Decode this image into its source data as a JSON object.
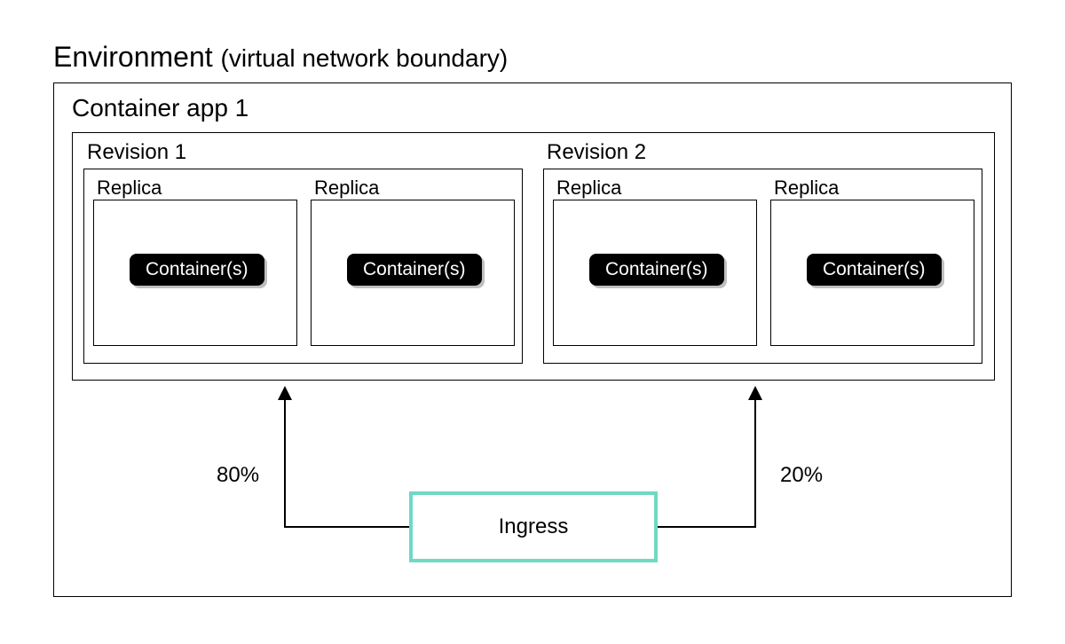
{
  "title_main": "Environment",
  "title_sub": "(virtual network boundary)",
  "app": {
    "title": "Container app 1",
    "revisions": [
      {
        "title": "Revision 1",
        "replicas": [
          {
            "title": "Replica",
            "container_label": "Container(s)"
          },
          {
            "title": "Replica",
            "container_label": "Container(s)"
          }
        ]
      },
      {
        "title": "Revision 2",
        "replicas": [
          {
            "title": "Replica",
            "container_label": "Container(s)"
          },
          {
            "title": "Replica",
            "container_label": "Container(s)"
          }
        ]
      }
    ]
  },
  "ingress_label": "Ingress",
  "traffic": {
    "revision1": "80%",
    "revision2": "20%"
  }
}
